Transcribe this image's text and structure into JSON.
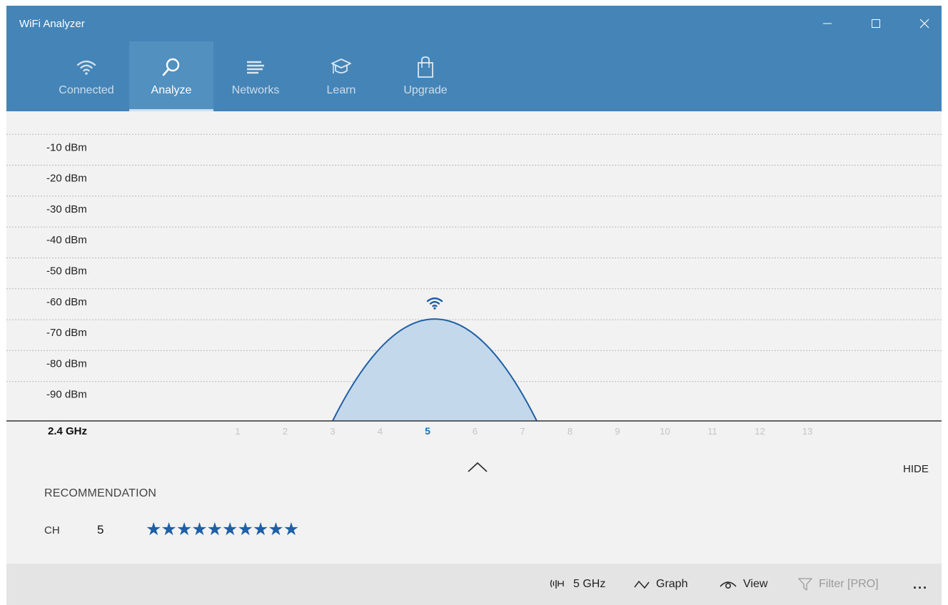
{
  "window": {
    "title": "WiFi Analyzer",
    "controls": {
      "minimize": "minimize",
      "maximize": "maximize",
      "close": "close"
    }
  },
  "nav": {
    "tabs": [
      {
        "label": "Connected",
        "icon": "wifi-icon",
        "active": false
      },
      {
        "label": "Analyze",
        "icon": "magnifier-icon",
        "active": true
      },
      {
        "label": "Networks",
        "icon": "list-lines-icon",
        "active": false
      },
      {
        "label": "Learn",
        "icon": "graduation-cap-icon",
        "active": false
      },
      {
        "label": "Upgrade",
        "icon": "shopping-bag-icon",
        "active": false
      }
    ]
  },
  "chart_data": {
    "type": "area",
    "band_label": "2.4 GHz",
    "y_ticks": [
      "-10 dBm",
      "-20 dBm",
      "-30 dBm",
      "-40 dBm",
      "-50 dBm",
      "-60 dBm",
      "-70 dBm",
      "-80 dBm",
      "-90 dBm"
    ],
    "y_values": [
      -10,
      -20,
      -30,
      -40,
      -50,
      -60,
      -70,
      -80,
      -90
    ],
    "ylim": [
      -100,
      0
    ],
    "x_ticks": [
      "1",
      "2",
      "3",
      "4",
      "5",
      "6",
      "7",
      "8",
      "9",
      "10",
      "11",
      "12",
      "13"
    ],
    "highlighted_channel": "5",
    "grid": true,
    "series": [
      {
        "channel": 5,
        "range": [
          3,
          7.3
        ],
        "peak_dbm": -67,
        "color": "#1f5fa6",
        "fill": "#c3d8ea"
      }
    ],
    "network_marker_icon": "wifi-icon"
  },
  "toggle": {
    "hide_label": "HIDE",
    "chevron_icon": "chevron-up-icon"
  },
  "recommendation": {
    "title": "RECOMMENDATION",
    "ch_label": "CH",
    "channel": "5",
    "stars": "★★★★★★★★★★",
    "rating": 10,
    "rating_max": 10
  },
  "command_bar": {
    "band": {
      "label": "5 GHz",
      "icon": "antenna-icon"
    },
    "graph": {
      "label": "Graph",
      "icon": "graph-line-icon"
    },
    "view": {
      "label": "View",
      "icon": "eye-icon"
    },
    "filter": {
      "label": "Filter [PRO]",
      "icon": "filter-funnel-icon",
      "disabled": true
    },
    "more": {
      "label": "...",
      "icon": "more-icon"
    }
  },
  "colors": {
    "header": "#4584b6",
    "accent": "#1f5fa6",
    "curve_fill": "#c3d8ea",
    "background": "#f2f2f2",
    "command_bar": "#e4e4e4"
  }
}
